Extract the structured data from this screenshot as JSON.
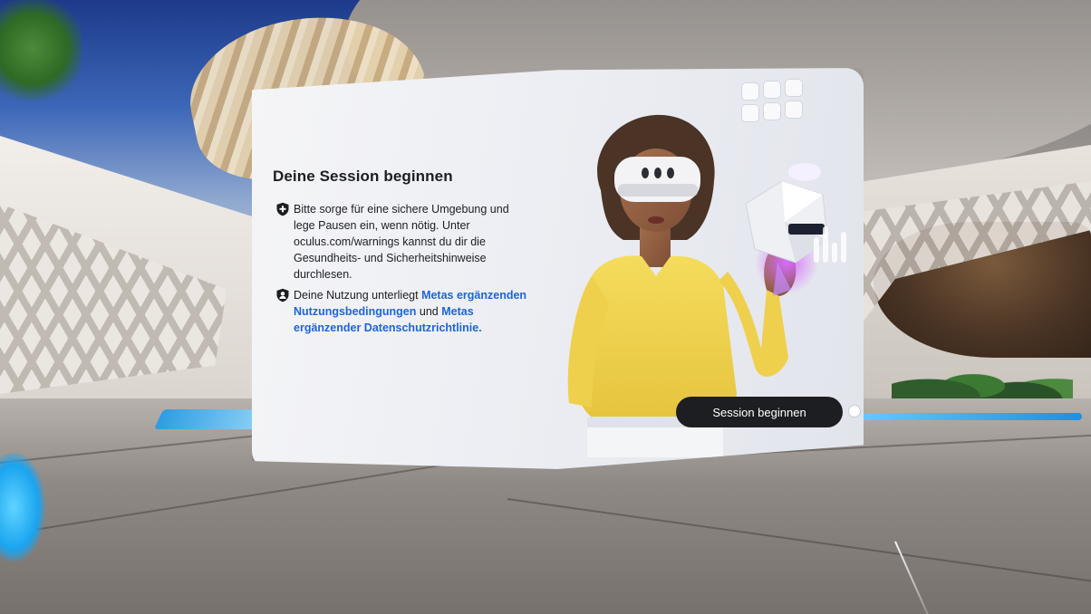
{
  "dialog": {
    "title": "Deine Session beginnen",
    "safety": {
      "icon": "shield-plus-icon",
      "text": "Bitte sorge für eine sichere Umgebung und lege Pausen ein, wenn nötig. Unter oculus.com/warnings kannst du dir die Gesundheits- und Sicherheitshinweise durchlesen."
    },
    "terms": {
      "icon": "shield-person-icon",
      "prefix": "Deine Nutzung unterliegt ",
      "link1": "Metas ergänzenden Nutzungsbedingungen",
      "middle": " und ",
      "link2": "Metas ergänzender Datenschutzrichtlinie",
      "suffix": "."
    },
    "primary_button": "Session beginnen"
  },
  "colors": {
    "link": "#1d65d8",
    "button_bg": "#1c1e21",
    "button_text": "#ffffff",
    "text": "#1c1e21"
  }
}
